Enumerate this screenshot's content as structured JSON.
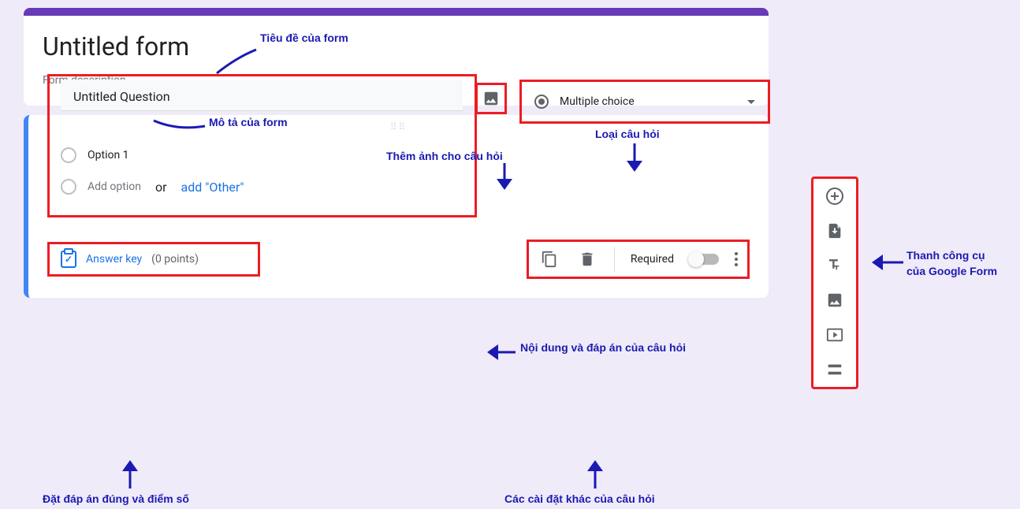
{
  "formHeader": {
    "title": "Untitled form",
    "description": "Form description"
  },
  "question": {
    "title": "Untitled Question",
    "option1": "Option 1",
    "addOption": "Add option",
    "or": "or",
    "addOther": "add \"Other\"",
    "type": "Multiple choice"
  },
  "footer": {
    "answerKey": "Answer key",
    "points": "(0 points)",
    "required": "Required"
  },
  "annotations": {
    "formTitle": "Tiêu đề của form",
    "formDesc": "Mô tả của form",
    "addImage": "Thêm ảnh cho câu hỏi",
    "questionType": "Loại câu hỏi",
    "content": "Nội dung và đáp án của câu hỏi",
    "toolbar1": "Thanh công cụ",
    "toolbar2": "của Google Form",
    "answerKey": "Đặt đáp án đúng và điểm số",
    "otherSettings": "Các cài đặt khác của câu hỏi"
  }
}
